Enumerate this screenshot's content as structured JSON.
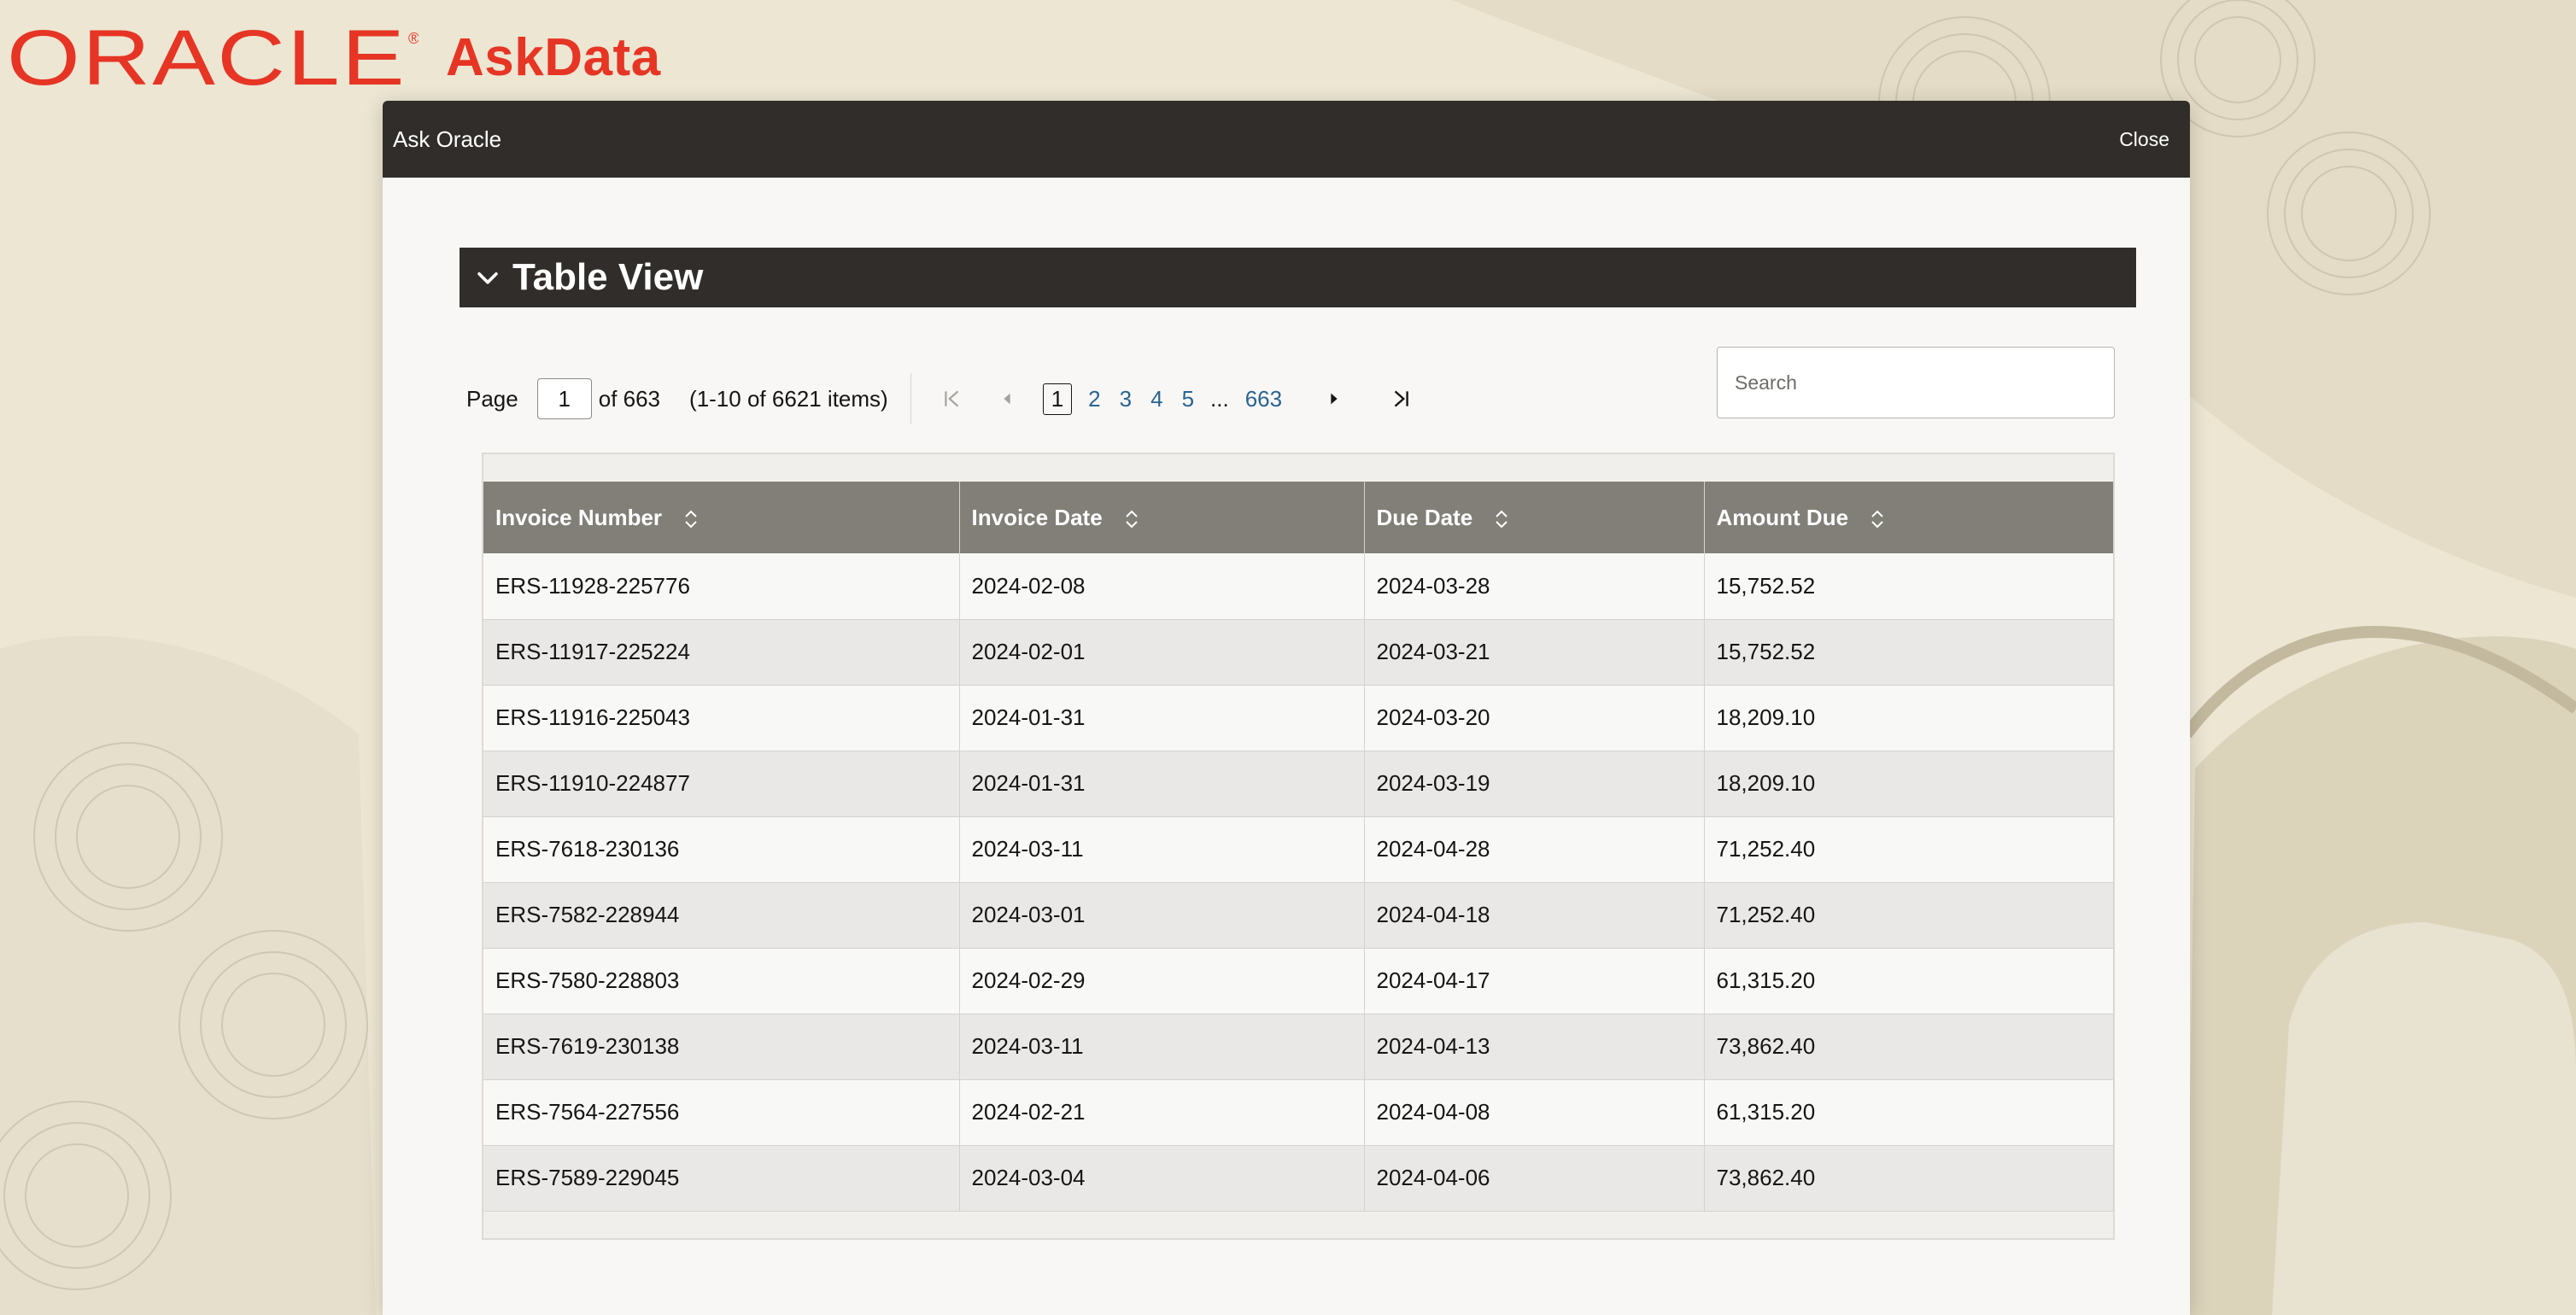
{
  "app": {
    "logo_text": "ORACLE",
    "title": "AskData"
  },
  "dialog": {
    "title": "Ask Oracle",
    "close_label": "Close"
  },
  "section": {
    "title": "Table View"
  },
  "pager": {
    "page_label": "Page",
    "current_page": "1",
    "of_label": "of 663",
    "items_label": "(1-10 of 6621 items)",
    "pages": [
      "2",
      "3",
      "4",
      "5"
    ],
    "selected": "1",
    "ellipsis": "...",
    "last_page": "663"
  },
  "search": {
    "placeholder": "Search"
  },
  "table": {
    "columns": [
      "Invoice Number",
      "Invoice Date",
      "Due Date",
      "Amount Due"
    ],
    "rows": [
      [
        "ERS-11928-225776",
        "2024-02-08",
        "2024-03-28",
        "15,752.52"
      ],
      [
        "ERS-11917-225224",
        "2024-02-01",
        "2024-03-21",
        "15,752.52"
      ],
      [
        "ERS-11916-225043",
        "2024-01-31",
        "2024-03-20",
        "18,209.10"
      ],
      [
        "ERS-11910-224877",
        "2024-01-31",
        "2024-03-19",
        "18,209.10"
      ],
      [
        "ERS-7618-230136",
        "2024-03-11",
        "2024-04-28",
        "71,252.40"
      ],
      [
        "ERS-7582-228944",
        "2024-03-01",
        "2024-04-18",
        "71,252.40"
      ],
      [
        "ERS-7580-228803",
        "2024-02-29",
        "2024-04-17",
        "61,315.20"
      ],
      [
        "ERS-7619-230138",
        "2024-03-11",
        "2024-04-13",
        "73,862.40"
      ],
      [
        "ERS-7564-227556",
        "2024-02-21",
        "2024-04-08",
        "61,315.20"
      ],
      [
        "ERS-7589-229045",
        "2024-03-04",
        "2024-04-06",
        "73,862.40"
      ]
    ]
  },
  "colors": {
    "brand_red": "#e63524",
    "header_dark": "#312d2a",
    "table_header": "#827f78",
    "link_blue": "#2b6390"
  },
  "icons": {
    "collapse": "chevron-down-icon",
    "sort": "sort-icon",
    "first": "first-page-icon",
    "prev": "previous-page-icon",
    "next": "next-page-icon",
    "last": "last-page-icon"
  }
}
